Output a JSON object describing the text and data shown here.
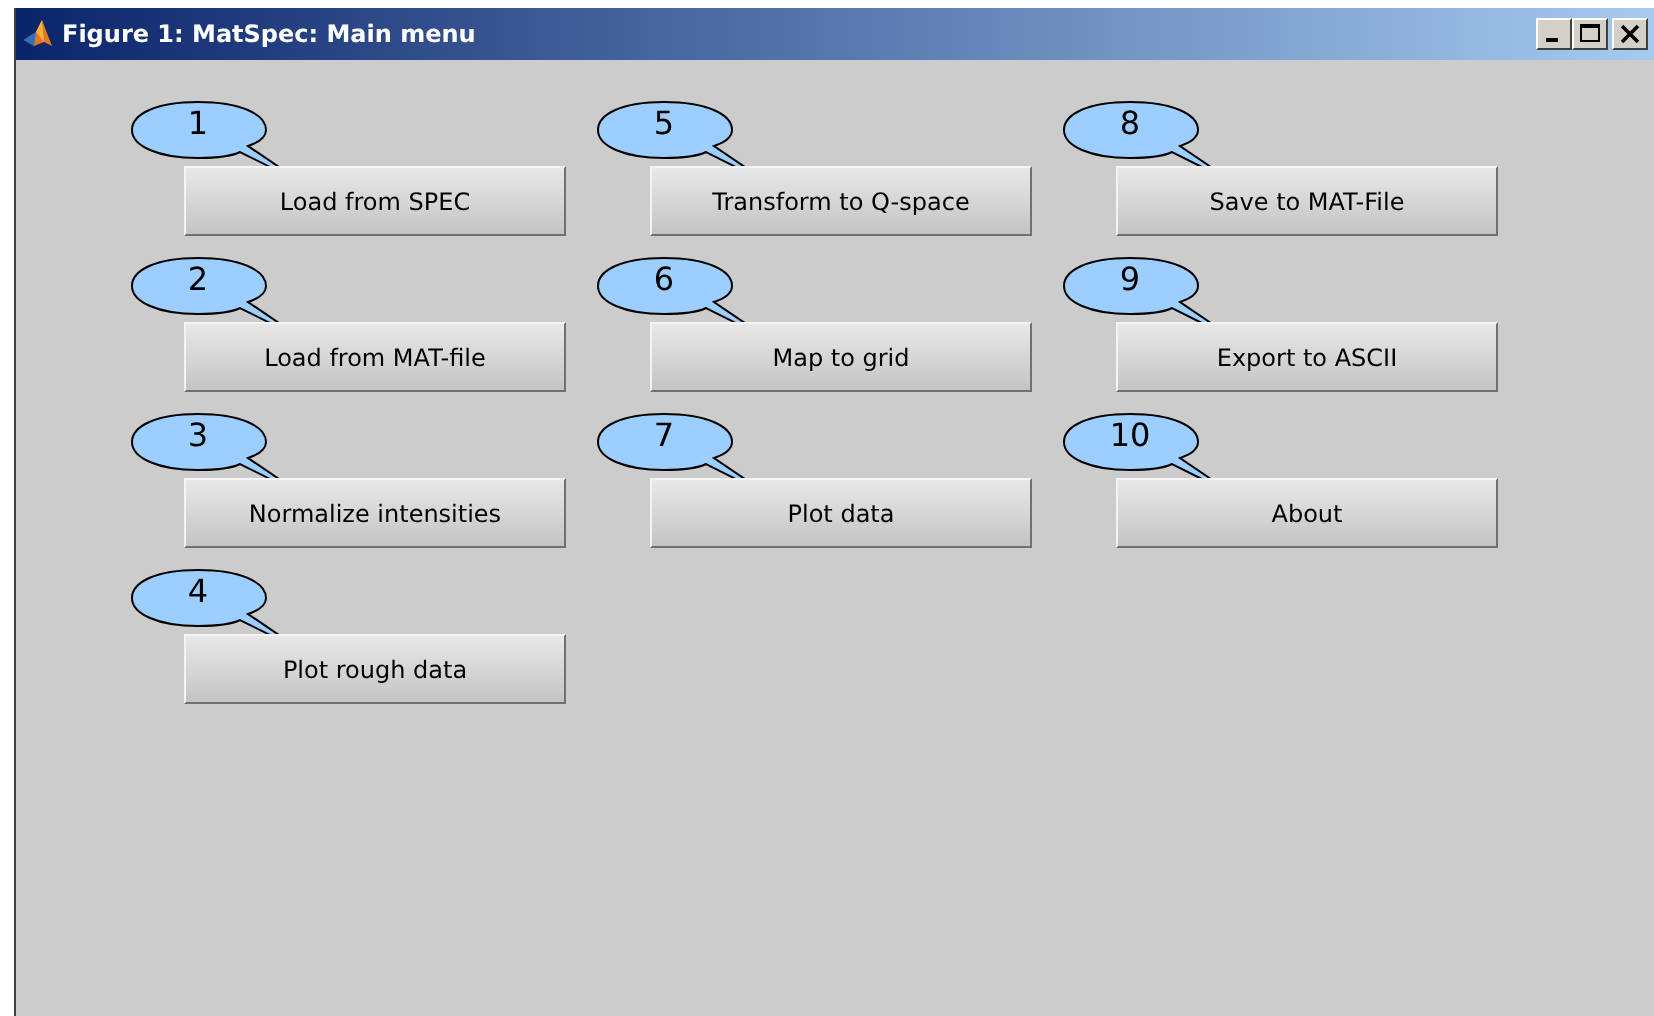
{
  "window": {
    "title": "Figure 1: MatSpec: Main menu"
  },
  "columns": [
    [
      {
        "number": "1",
        "label": "Load from SPEC"
      },
      {
        "number": "2",
        "label": "Load from MAT-file"
      },
      {
        "number": "3",
        "label": "Normalize intensities"
      },
      {
        "number": "4",
        "label": "Plot rough data"
      }
    ],
    [
      {
        "number": "5",
        "label": "Transform to Q-space"
      },
      {
        "number": "6",
        "label": "Map to grid"
      },
      {
        "number": "7",
        "label": "Plot data"
      }
    ],
    [
      {
        "number": "8",
        "label": "Save to MAT-File"
      },
      {
        "number": "9",
        "label": "Export to ASCII"
      },
      {
        "number": "10",
        "label": "About"
      }
    ]
  ]
}
